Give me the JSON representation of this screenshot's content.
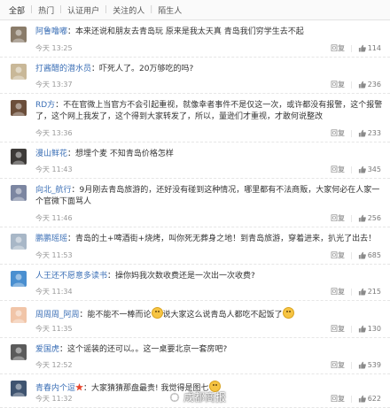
{
  "tabs": [
    {
      "label": "全部"
    },
    {
      "label": "热门"
    },
    {
      "label": "认证用户"
    },
    {
      "label": "关注的人"
    },
    {
      "label": "陌生人"
    }
  ],
  "reply_label": "回复",
  "comments": [
    {
      "user": "阿鲁噜嘟",
      "text": "本来还说和朋友去青岛玩 原来是我太天真 青岛我们穷学生去不起",
      "time": "今天 13:25",
      "likes": "114",
      "avatar_bg": "#8a7c6a"
    },
    {
      "user": "打酱醋的潜水员",
      "text": "吓死人了。20万够吃的吗?",
      "time": "今天 13:37",
      "likes": "236",
      "avatar_bg": "#c9b898"
    },
    {
      "user": "RD方",
      "text": "不在官微上当官方不会引起重视，就像幸者事件不是仅这一次，或许都没有报警，这个报警了，这个网上我发了，这个得到大家转发了，所以，量逊们才重视，才敢何说整改",
      "time": "今天 13:36",
      "likes": "233",
      "avatar_bg": "#6b4e3a"
    },
    {
      "user": "漫山鲜花",
      "text": "想埋个麦 不知青岛价格怎样",
      "time": "今天 11:43",
      "likes": "345",
      "avatar_bg": "#3d3a38"
    },
    {
      "user": "向北_航行",
      "text": "9月刚去青岛旅游的，还好没有碰到这种情况，哪里都有不法商贩，大家何必在人家一个官微下面骂人",
      "time": "今天 11:46",
      "likes": "256",
      "avatar_bg": "#7c86a1"
    },
    {
      "user": "鹏鹏瑶瑶",
      "text": "青岛的土+啤酒街+烧烤，叫你死无葬身之地！到青岛旅游，穿着进来，扒光了出去！",
      "time": "今天 11:53",
      "likes": "685",
      "avatar_bg": "#a8b7c7"
    },
    {
      "user": "人王还不愿意多读书",
      "text": "操你妈我次数收费还是一次出一次收费?",
      "time": "今天 11:34",
      "likes": "215",
      "avatar_bg": "#4a8fd0"
    },
    {
      "user": "周周周_阿周",
      "text": "能不能不一棒而论",
      "text2": "说大家这么说青岛人都吃不起饭了",
      "time": "今天 11:35",
      "likes": "130",
      "avatar_bg": "#f1c5a8"
    },
    {
      "user": "爱国虎",
      "text": "这个谣装的还可以。。这一桌要北京一套房吧?",
      "time": "今天 12:52",
      "likes": "539",
      "avatar_bg": "#5b5b5b"
    },
    {
      "user": "青春内个逗",
      "text": "大家猜猜那盘最贵! 我觉得是图七",
      "time": "今天 11:32",
      "likes": "622",
      "avatar_bg": "#3f5470"
    }
  ],
  "watermark": "成都商报",
  "colors": {
    "link": "#3b6fb6",
    "meta": "#999999",
    "emoji": "#f6c443"
  }
}
